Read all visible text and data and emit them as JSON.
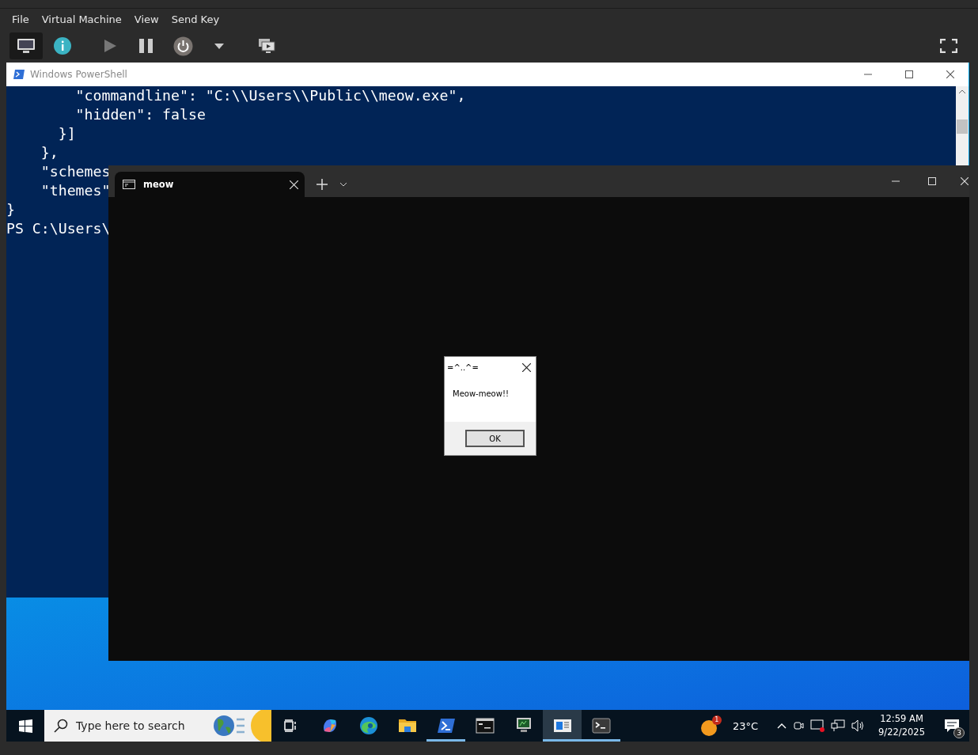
{
  "menu": [
    "File",
    "Virtual Machine",
    "View",
    "Send Key"
  ],
  "toolbar": [
    {
      "kind": "console",
      "selected": true
    },
    {
      "kind": "info",
      "selected": false
    },
    {
      "kind": "play",
      "selected": false
    },
    {
      "kind": "pause",
      "selected": false
    },
    {
      "kind": "power",
      "selected": false
    },
    {
      "kind": "caret",
      "selected": false
    },
    {
      "kind": "screens",
      "selected": false
    }
  ],
  "powershell": {
    "title": "Windows PowerShell",
    "lines": [
      "        \"commandline\": \"C:\\\\Users\\\\Public\\\\meow.exe\",",
      "        \"hidden\": false",
      "      }]",
      "    },",
      "    \"schemes",
      "    \"themes\"",
      "}",
      "PS C:\\Users\\"
    ]
  },
  "terminal": {
    "tabs": [
      {
        "label": "meow",
        "selected": true
      }
    ]
  },
  "dialog": {
    "title": "=^..^=",
    "message": "Meow-meow!!",
    "button": "OK"
  },
  "taskbar": {
    "search": {
      "placeholder": "Type here to search"
    },
    "apps": [
      {
        "kind": "taskview",
        "running": false,
        "active": false
      },
      {
        "kind": "copilot",
        "running": false,
        "active": false
      },
      {
        "kind": "edge",
        "running": false,
        "active": false
      },
      {
        "kind": "folder",
        "running": false,
        "active": false
      },
      {
        "kind": "powershell",
        "running": true,
        "active": false
      },
      {
        "kind": "cmd",
        "running": false,
        "active": false
      },
      {
        "kind": "monitor",
        "running": false,
        "active": false
      },
      {
        "kind": "window",
        "running": true,
        "active": true
      },
      {
        "kind": "terminal",
        "running": true,
        "active": false
      }
    ],
    "weather": {
      "badge": "1",
      "temp": "23°C"
    },
    "time": "12:59 AM",
    "date": "9/22/2025",
    "notifications": "3"
  }
}
